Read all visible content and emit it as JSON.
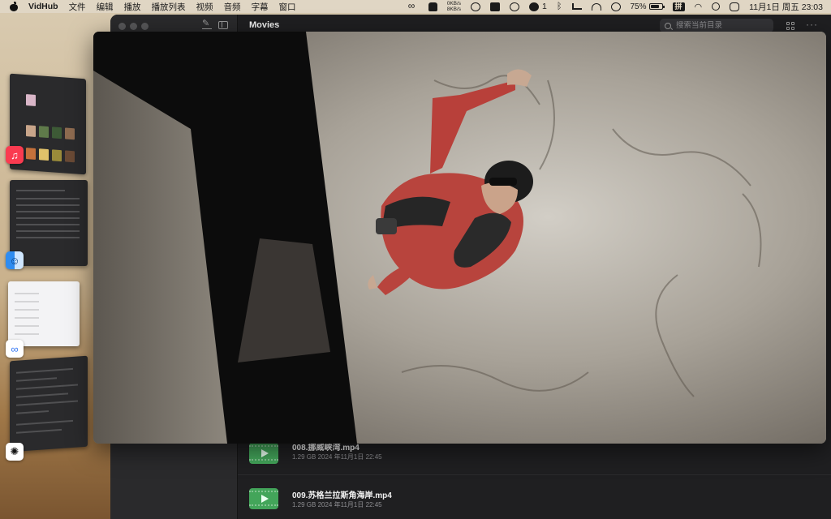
{
  "menubar": {
    "app_name": "VidHub",
    "menus": [
      "文件",
      "编辑",
      "播放",
      "播放列表",
      "视频",
      "音频",
      "字幕",
      "窗口"
    ],
    "net_up": "0KB/s",
    "net_down": "8KB/s",
    "wechat_count": "1",
    "battery_percent": "75%",
    "ime": "拼",
    "clock": "11月1日 周五  23:03"
  },
  "stage_manager": {
    "apps": [
      {
        "name": "Music",
        "icon": "music-icon",
        "color": "#fa3b50"
      },
      {
        "name": "Finder",
        "icon": "finder-icon",
        "color": "#2f8cf0"
      },
      {
        "name": "Baidu Netdisk",
        "icon": "netdisk-icon",
        "color": "#ffffff"
      },
      {
        "name": "ChatGPT",
        "icon": "chatgpt-icon",
        "color": "#ffffff"
      }
    ]
  },
  "vidhub": {
    "title": "Movies",
    "search_placeholder": "搜索当前目录",
    "files": [
      {
        "name": "008.挪威峡湾.mp4",
        "meta": "1.29 GB  2024 年11月1日 22:45"
      },
      {
        "name": "009.苏格兰拉斯角海岸.mp4",
        "meta": "1.29 GB  2024 年11月1日 22:45"
      }
    ]
  },
  "player": {
    "content": "video-frame"
  }
}
